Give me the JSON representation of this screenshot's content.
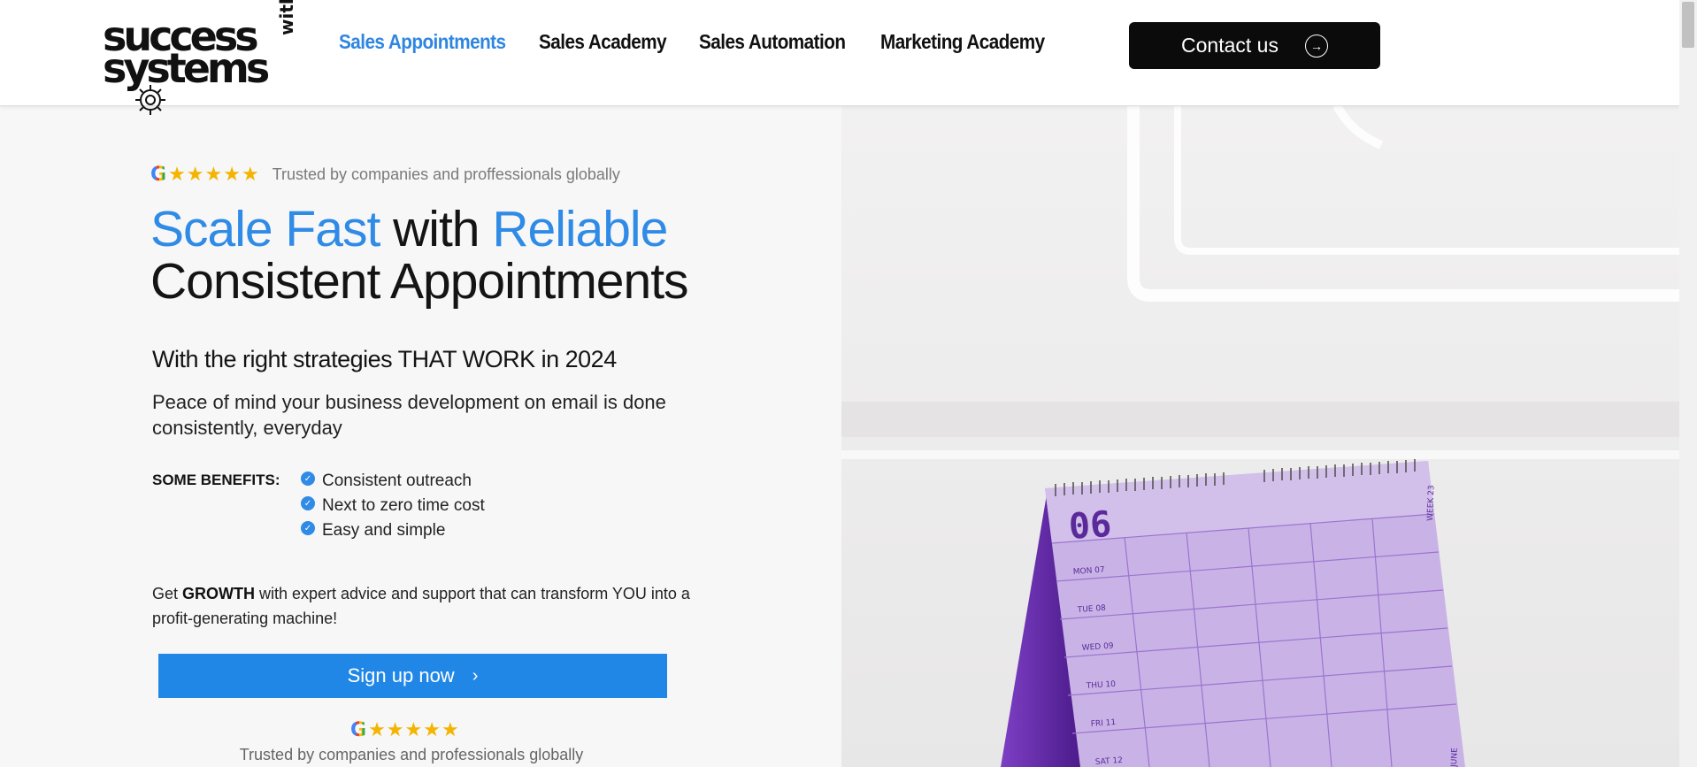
{
  "brand": {
    "logo_line1": "success",
    "logo_line2": "systems",
    "logo_with": "with"
  },
  "nav": {
    "items": [
      {
        "label": "Sales Appointments",
        "active": true
      },
      {
        "label": "Sales Academy",
        "active": false
      },
      {
        "label": "Sales Automation",
        "active": false
      },
      {
        "label": "Marketing Academy",
        "active": false
      }
    ],
    "contact_label": "Contact us"
  },
  "hero": {
    "rating_icons": {
      "google": "G",
      "stars": "★★★★★"
    },
    "trusted_text": "Trusted by companies and proffessionals globally",
    "title": {
      "part1": "Scale Fast",
      "part2": " with ",
      "part3": "Reliable",
      "line2": "Consistent Appointments"
    },
    "subheading": "With the right strategies THAT WORK in 2024",
    "description": "Peace of mind your business development on email is done consistently, everyday",
    "benefits_label": "SOME BENEFITS:",
    "benefits": [
      "Consistent outreach",
      "Next to zero time cost",
      "Easy and simple"
    ],
    "growth": {
      "prefix": "Get ",
      "bold": "GROWTH",
      "suffix": " with expert advice and support that can transform YOU into a profit-generating machine!"
    },
    "signup_label": "Sign up now",
    "trusted_text_bottom": "Trusted by companies and professionals globally"
  },
  "calendar": {
    "month_number": "06",
    "days": [
      "MON 07",
      "TUE 08",
      "WED 09",
      "THU 10",
      "FRI 11",
      "SAT 12"
    ],
    "week_label": "WEEK 23",
    "month_label": "JUNE"
  },
  "colors": {
    "accent": "#2f8be6",
    "button_dark": "#0b0b0b",
    "signup_blue": "#2187e6",
    "calendar_purple": "#c9b3e6",
    "calendar_ink": "#5a2a9a"
  },
  "icons": {
    "arrow": "circle-arrow-right-icon",
    "chevron": "chevron-right-icon",
    "check": "check-circle-icon",
    "star": "star-icon",
    "google": "google-icon",
    "gear": "gear-icon"
  }
}
